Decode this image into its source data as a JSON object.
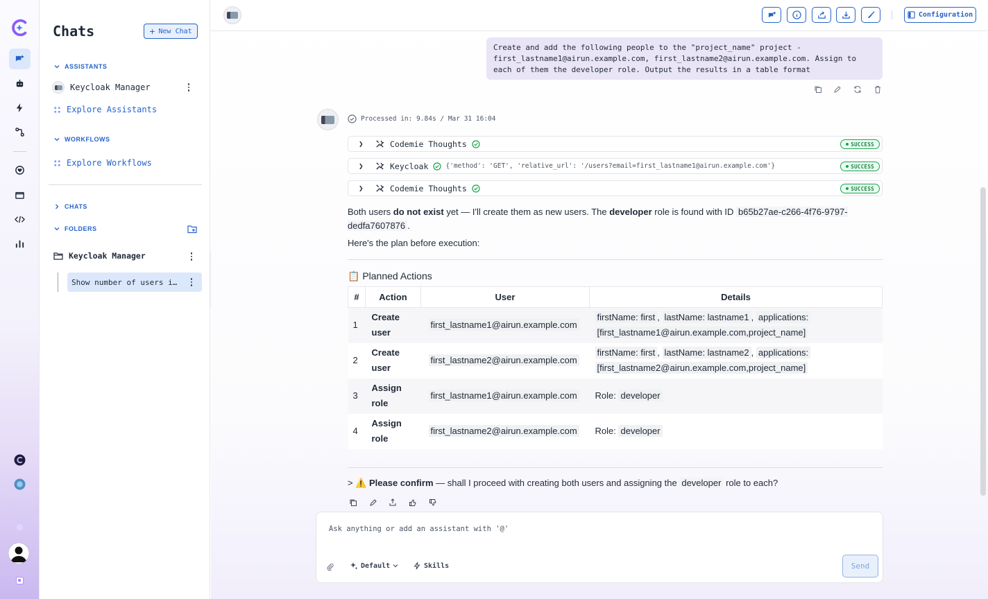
{
  "sidebar": {
    "title": "Chats",
    "new_chat_label": "New Chat",
    "assistants_header": "ASSISTANTS",
    "assistant_item": "Keycloak Manager",
    "explore_assistants": "Explore Assistants",
    "workflows_header": "WORKFLOWS",
    "explore_workflows": "Explore Workflows",
    "chats_header": "CHATS",
    "folders_header": "FOLDERS",
    "folder_name": "Keycloak Manager",
    "folder_chat": "Show number of users i…"
  },
  "topbar": {
    "configuration_label": "Configuration"
  },
  "conversation": {
    "user_message": "Create and add the following people to the \"project_name\" project - first_lastname1@airun.example.com, first_lastname2@airun.example.com. Assign to each of them the developer role. Output the results in a table format",
    "processed": "Processed in: 9.84s / Mar 31 16:04",
    "tools": [
      {
        "name": "Codemie Thoughts",
        "args": "",
        "status": "SUCCESS"
      },
      {
        "name": "Keycloak",
        "args": "{'method': 'GET', 'relative_url': '/users?email=first_lastname1@airun.example.com'}",
        "status": "SUCCESS"
      },
      {
        "name": "Codemie Thoughts",
        "args": "",
        "status": "SUCCESS"
      }
    ],
    "para1_a": "Both users ",
    "para1_b": "do not exist",
    "para1_c": " yet — I'll create them as new users. The ",
    "para1_d": "developer",
    "para1_e": " role is found with ID ",
    "para1_id": "b65b27ae-c266-4f76-9797-dedfa7607876",
    "para1_f": ".",
    "para2": "Here's the plan before execution:",
    "plan_heading": "📋 Planned Actions",
    "table_headers": [
      "#",
      "Action",
      "User",
      "Details"
    ],
    "rows": [
      {
        "n": "1",
        "action": "Create user",
        "user": "first_lastname1@airun.example.com",
        "d1": "firstName: first",
        "d2": "lastName: lastname1",
        "d3": "applications:",
        "d4": "[first_lastname1@airun.example.com,project_name]"
      },
      {
        "n": "2",
        "action": "Create user",
        "user": "first_lastname2@airun.example.com",
        "d1": "firstName: first",
        "d2": "lastName: lastname2",
        "d3": "applications:",
        "d4": "[first_lastname2@airun.example.com,project_name]"
      },
      {
        "n": "3",
        "action": "Assign role",
        "user": "first_lastname1@airun.example.com",
        "role_label": "Role:",
        "role": "developer"
      },
      {
        "n": "4",
        "action": "Assign role",
        "user": "first_lastname2@airun.example.com",
        "role_label": "Role:",
        "role": "developer"
      }
    ],
    "confirm_a": "> ⚠️ ",
    "confirm_b": "Please confirm",
    "confirm_c": " — shall I proceed with creating both users and assigning the ",
    "confirm_d": "developer",
    "confirm_e": " role to each?"
  },
  "composer": {
    "placeholder": "Ask anything or add an assistant with '@'",
    "model_label": "Default",
    "skills_label": "Skills",
    "send_label": "Send"
  }
}
